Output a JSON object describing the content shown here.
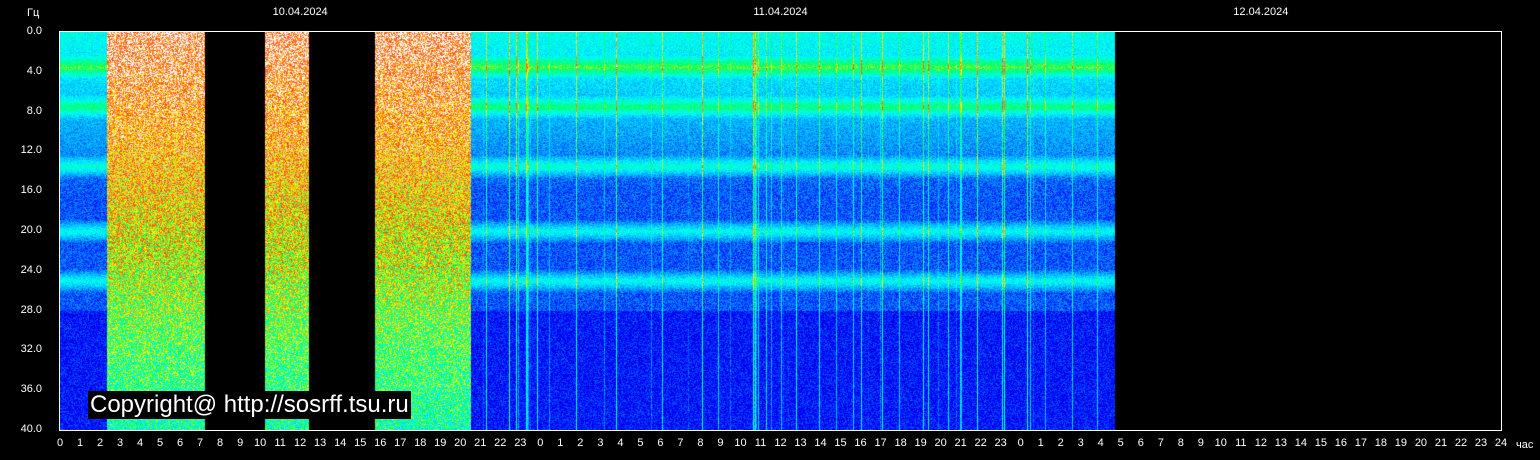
{
  "chart_data": {
    "type": "heatmap",
    "ylabel": "Гц",
    "xlabel": "час",
    "y_ticks": [
      "0.0",
      "4.0",
      "8.0",
      "12.0",
      "16.0",
      "20.0",
      "24.0",
      "28.0",
      "32.0",
      "36.0",
      "40.0"
    ],
    "ylim": [
      0,
      40
    ],
    "x_ticks": [
      "0",
      "1",
      "2",
      "3",
      "4",
      "5",
      "6",
      "7",
      "8",
      "9",
      "10",
      "11",
      "12",
      "13",
      "14",
      "15",
      "16",
      "17",
      "18",
      "19",
      "20",
      "21",
      "22",
      "23",
      "0",
      "1",
      "2",
      "3",
      "4",
      "5",
      "6",
      "7",
      "8",
      "9",
      "10",
      "11",
      "12",
      "13",
      "14",
      "15",
      "16",
      "17",
      "18",
      "19",
      "20",
      "21",
      "22",
      "23",
      "0",
      "1",
      "2",
      "3",
      "4",
      "5",
      "6",
      "7",
      "8",
      "9",
      "10",
      "11",
      "12",
      "13",
      "14",
      "15",
      "16",
      "17",
      "18",
      "19",
      "20",
      "21",
      "22",
      "23",
      "24"
    ],
    "xlim_hours": [
      0,
      72
    ],
    "dates": [
      {
        "label": "10.04.2024",
        "hour": 12
      },
      {
        "label": "11.04.2024",
        "hour": 36
      },
      {
        "label": "12.04.2024",
        "hour": 60
      }
    ],
    "data_end_hour": 52.7,
    "gaps_hours": [
      [
        7.2,
        10.2
      ],
      [
        12.4,
        15.7
      ]
    ],
    "saturated_intervals_hours": [
      [
        2.3,
        7.2
      ],
      [
        10.2,
        12.4
      ],
      [
        15.7,
        20.5
      ]
    ],
    "resonance_bands_hz": [
      3.5,
      7.5,
      13.5,
      20,
      25
    ],
    "colorscale": [
      "#000080",
      "#0000ff",
      "#00a0ff",
      "#00ffff",
      "#00ff60",
      "#ffff00",
      "#ff4000",
      "#ffffff"
    ],
    "grid": false,
    "legend": "none"
  },
  "copyright": "Copyright@ http://sosrff.tsu.ru"
}
